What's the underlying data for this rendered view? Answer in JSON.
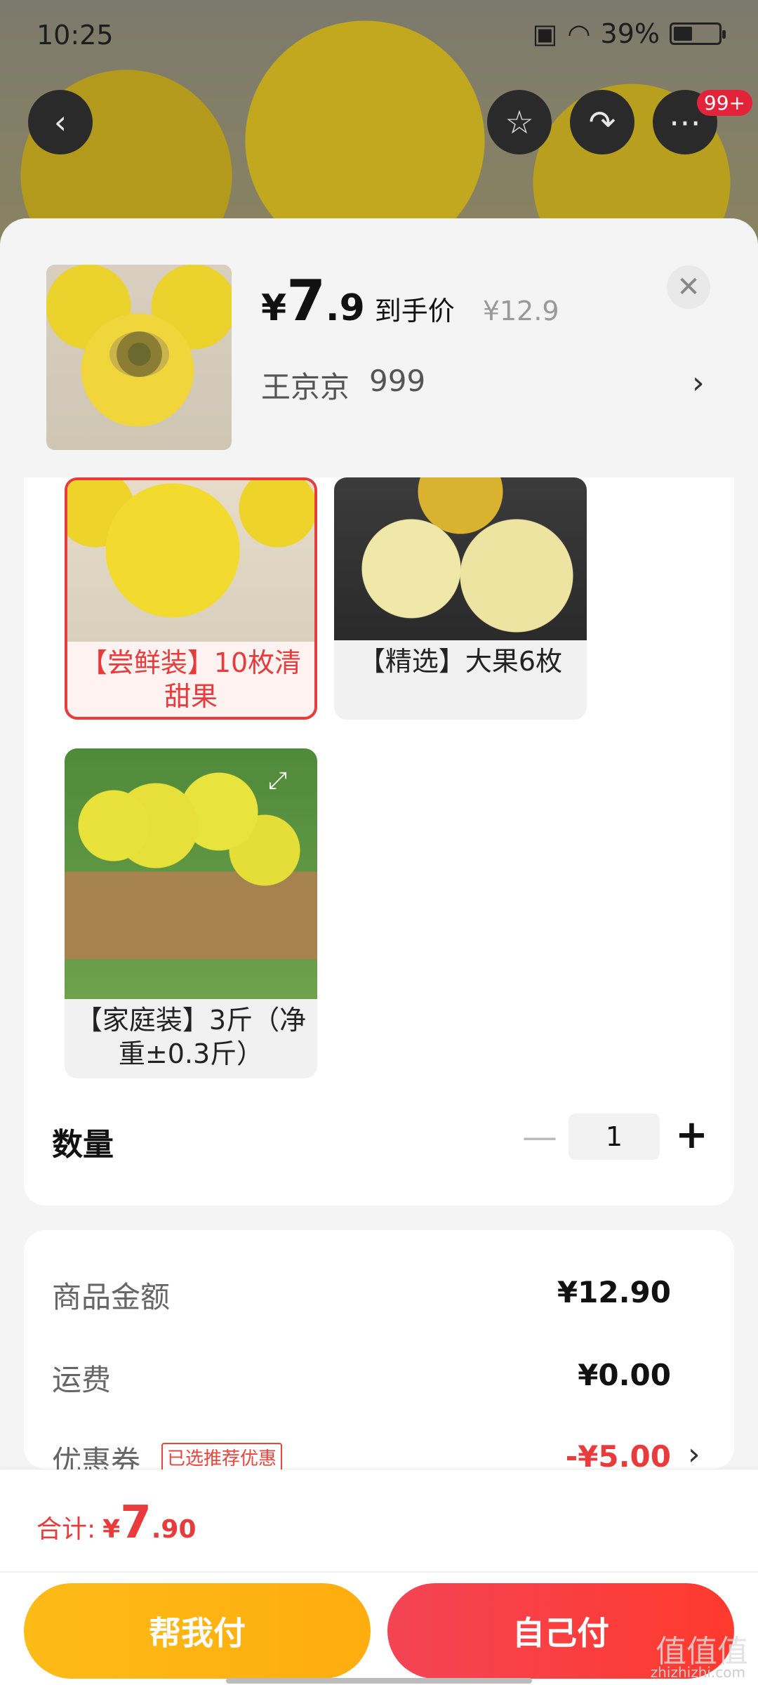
{
  "status_bar": {
    "time": "10:25",
    "battery": "39%",
    "battery_fill": 0.39
  },
  "top_actions": {
    "notification_badge": "99+"
  },
  "header": {
    "price_yen": "¥",
    "price_int": "7",
    "price_dec": ".9",
    "price_tag": "到手价",
    "original_price": "¥12.9",
    "spec_name": "王京京",
    "spec_value": "999"
  },
  "options": [
    {
      "label": "【尝鲜装】10枚清甜果",
      "selected": true
    },
    {
      "label": "【精选】大果6枚",
      "selected": false
    },
    {
      "label": "【家庭装】3斤（净重±0.3斤）",
      "selected": false
    }
  ],
  "quantity": {
    "label": "数量",
    "value": "1"
  },
  "summary": {
    "goods_label": "商品金额",
    "goods_value": "¥12.90",
    "shipping_label": "运费",
    "shipping_value": "¥0.00",
    "coupon_label": "优惠券",
    "coupon_tag": "已选推荐优惠",
    "coupon_value": "-¥5.00"
  },
  "footer": {
    "total_label": "合计:",
    "total_yen": "¥",
    "total_int": "7",
    "total_dec": ".90",
    "help_pay": "帮我付",
    "self_pay": "自己付"
  },
  "watermark": {
    "glyph": "值值值",
    "site": "zhizhizhi.com"
  },
  "colors": {
    "accent_red": "#e83b3b",
    "help_btn": "#fdbb17",
    "self_btn": "#f44455"
  }
}
